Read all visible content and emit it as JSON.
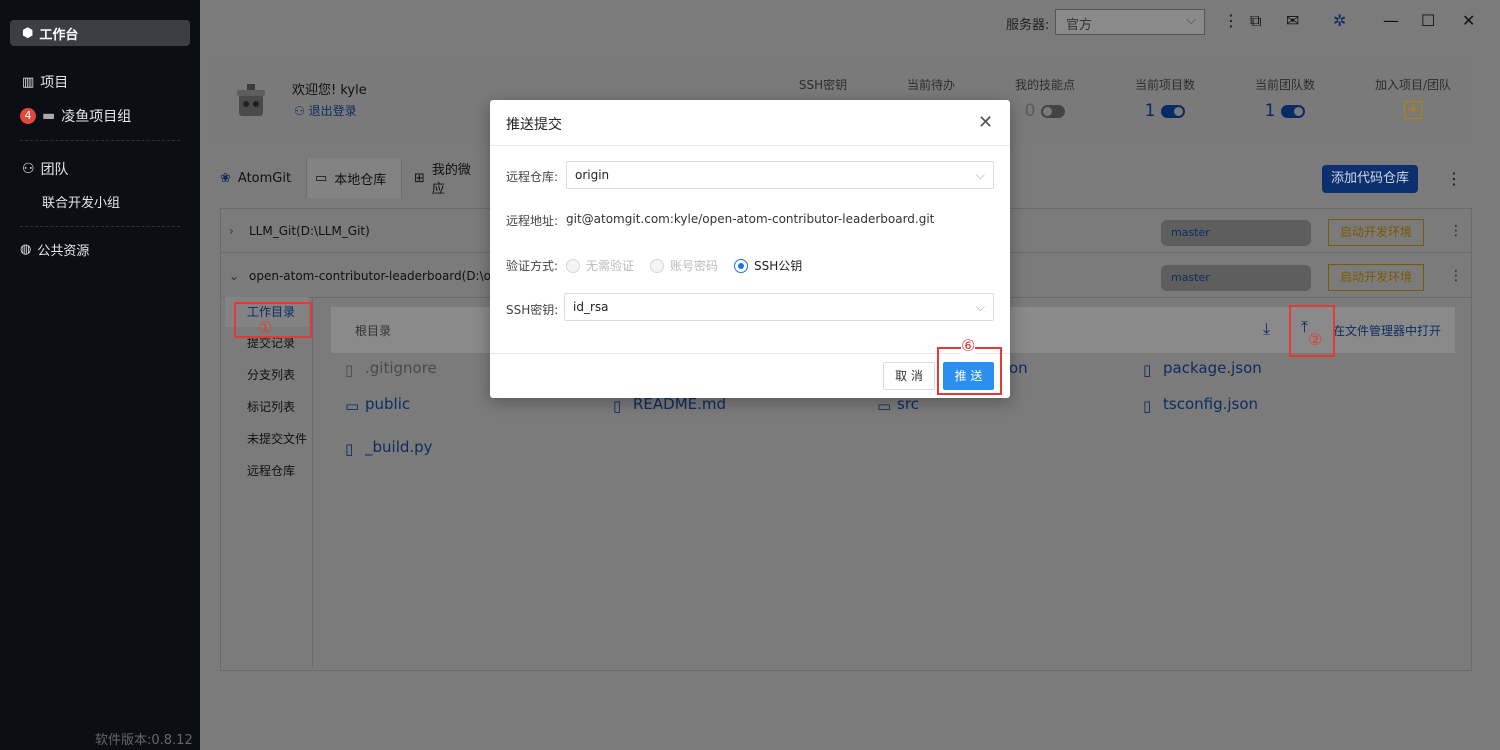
{
  "sidebar": {
    "active": "工作台",
    "items": [
      {
        "label": "项目"
      },
      {
        "label": "凌鱼项目组",
        "badge": "4"
      },
      {
        "label": "团队"
      },
      {
        "label": "联合开发小组"
      },
      {
        "label": "公共资源"
      }
    ],
    "version": "软件版本:0.8.12"
  },
  "topbar": {
    "server_label": "服务器:",
    "server_value": "官方"
  },
  "user": {
    "welcome": "欢迎您! kyle",
    "logout": "退出登录"
  },
  "stats": [
    {
      "label": "SSH密钥",
      "value": ""
    },
    {
      "label": "当前待办",
      "value": ""
    },
    {
      "label": "我的技能点",
      "value": "0"
    },
    {
      "label": "当前项目数",
      "value": "1"
    },
    {
      "label": "当前团队数",
      "value": "1"
    },
    {
      "label": "加入项目/团队",
      "value": ""
    }
  ],
  "tabs": [
    {
      "label": "AtomGit"
    },
    {
      "label": "本地仓库"
    },
    {
      "label": "我的微应"
    }
  ],
  "add_repo_button": "添加代码仓库",
  "repos": [
    {
      "name": "LLM_Git(D:\\LLM_Git)",
      "branch": "master",
      "env_button": "启动开发环境"
    },
    {
      "name": "open-atom-contributor-leaderboard(D:\\open",
      "branch": "master",
      "env_button": "启动开发环境"
    }
  ],
  "left_nav": [
    "工作目录",
    "提交记录",
    "分支列表",
    "标记列表",
    "未提交文件",
    "远程仓库"
  ],
  "file_header": {
    "root": "根目录",
    "open_in_explorer": "在文件管理器中打开"
  },
  "files": [
    {
      "name": ".gitignore"
    },
    {
      "name": "on"
    },
    {
      "name": "package.json"
    },
    {
      "name": "public"
    },
    {
      "name": "README.md"
    },
    {
      "name": "src"
    },
    {
      "name": "tsconfig.json"
    },
    {
      "name": "_build.py"
    }
  ],
  "annotations": {
    "one": "①",
    "two": "②",
    "six": "⑥"
  },
  "modal": {
    "title": "推送提交",
    "remote_repo_label": "远程仓库:",
    "remote_repo_value": "origin",
    "remote_url_label": "远程地址:",
    "remote_url_value": "git@atomgit.com:kyle/open-atom-contributor-leaderboard.git",
    "auth_label": "验证方式:",
    "auth_options": [
      "无需验证",
      "账号密码",
      "SSH公钥"
    ],
    "auth_selected": "SSH公钥",
    "ssh_key_label": "SSH密钥:",
    "ssh_key_value": "id_rsa",
    "cancel": "取 消",
    "push": "推 送"
  }
}
